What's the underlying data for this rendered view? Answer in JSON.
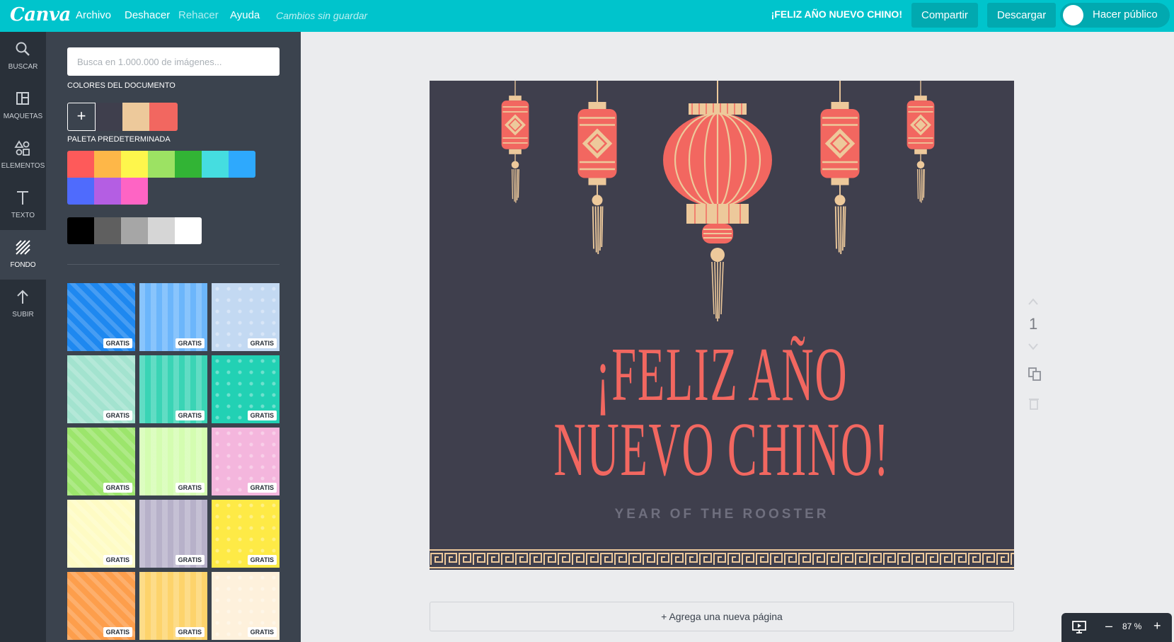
{
  "app": {
    "logo": "Canva"
  },
  "menu": {
    "archivo": "Archivo",
    "deshacer": "Deshacer",
    "rehacer": "Rehacer",
    "ayuda": "Ayuda",
    "status": "Cambios sin guardar"
  },
  "header": {
    "doc_title": "¡FELIZ AÑO NUEVO CHINO!",
    "share": "Compartir",
    "download": "Descargar",
    "publish": "Hacer público"
  },
  "rail": {
    "items": [
      {
        "label": "BUSCAR",
        "icon": "search-icon"
      },
      {
        "label": "MAQUETAS",
        "icon": "layout-icon"
      },
      {
        "label": "ELEMENTOS",
        "icon": "shapes-icon"
      },
      {
        "label": "TEXTO",
        "icon": "text-icon"
      },
      {
        "label": "FONDO",
        "icon": "background-icon",
        "active": true
      },
      {
        "label": "SUBIR",
        "icon": "upload-icon"
      }
    ]
  },
  "panel": {
    "search_placeholder": "Busca en 1.000.000 de imágenes...",
    "doc_colors_title": "COLORES DEL DOCUMENTO",
    "doc_colors": [
      "#3f3f4d",
      "#edc99b",
      "#f26760"
    ],
    "default_palette_title": "PALETA PREDETERMINADA",
    "palette_row1": [
      "#fe5a5a",
      "#feb748",
      "#fef64c",
      "#9ce263",
      "#32b435",
      "#45dde0",
      "#2ea9fd"
    ],
    "palette_row2": [
      "#4f6bfd",
      "#b45ee3",
      "#fe64c4"
    ],
    "grays": [
      "#000000",
      "#5f5f5f",
      "#a6a6a6",
      "#d6d6d6",
      "#ffffff"
    ],
    "badge": "GRATIS",
    "backgrounds": [
      {
        "name": "blue-hexagon",
        "color": "#1e88f0"
      },
      {
        "name": "blue-zigzag",
        "color": "#6cb6fb"
      },
      {
        "name": "light-blue-stripes",
        "color": "#c3d9f2"
      },
      {
        "name": "mint-diamonds",
        "color": "#a3e3cf"
      },
      {
        "name": "teal-dots",
        "color": "#3ad4b5"
      },
      {
        "name": "teal-stripes",
        "color": "#22d1b4"
      },
      {
        "name": "green-stripes",
        "color": "#9ce56c"
      },
      {
        "name": "lime-circles",
        "color": "#d4fdb1"
      },
      {
        "name": "pink-stripes",
        "color": "#f4b6dd"
      },
      {
        "name": "cream-dots",
        "color": "#fefbc4"
      },
      {
        "name": "lilac-stripes",
        "color": "#b7b1c9"
      },
      {
        "name": "yellow-watermelon",
        "color": "#feea46"
      },
      {
        "name": "orange-zigzag",
        "color": "#fd9e4c"
      },
      {
        "name": "yellow-circles",
        "color": "#fdd36b"
      },
      {
        "name": "cream-lines",
        "color": "#fef1dc"
      }
    ]
  },
  "design": {
    "headline_line1": "¡FELIZ AÑO",
    "headline_line2": "NUEVO CHINO!",
    "subtitle": "YEAR OF THE ROOSTER",
    "bg_color": "#3f3f4d",
    "accent": "#f26760",
    "gold": "#edc99b"
  },
  "page": {
    "number": "1"
  },
  "add_page": "+ Agrega una nueva página",
  "zoom": {
    "value": "87 %",
    "minus": "–",
    "plus": "+"
  }
}
